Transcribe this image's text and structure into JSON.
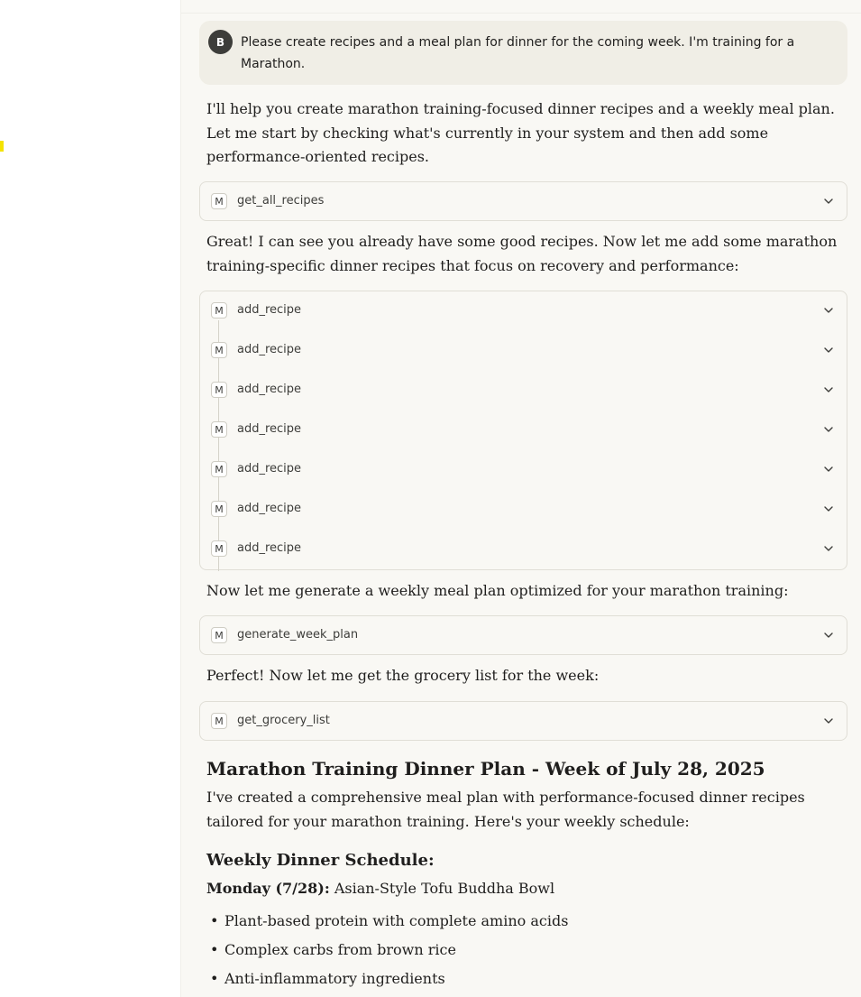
{
  "user_message": {
    "avatar_initial": "B",
    "text": "Please create recipes and a  meal plan for dinner for the coming week. I'm training for a Marathon."
  },
  "assistant": {
    "intro": "I'll help you create marathon training-focused dinner recipes and a weekly meal plan. Let me start by checking what's currently in your system and then add some performance-oriented recipes.",
    "after_get_all": "Great! I can see you already have some good recipes. Now let me add some marathon training-specific dinner recipes that focus on recovery and performance:",
    "before_plan": "Now let me generate a weekly meal plan optimized for your marathon training:",
    "before_grocery": "Perfect! Now let me get the grocery list for the week:",
    "heading": "Marathon Training Dinner Plan - Week of July 28, 2025",
    "summary": "I've created a comprehensive meal plan with performance-focused dinner recipes tailored for your marathon training. Here's your weekly schedule:",
    "schedule_heading": "Weekly Dinner Schedule:",
    "monday_label": "Monday (7/28):",
    "monday_meal": "Asian-Style Tofu Buddha Bowl",
    "monday_points": [
      "Plant-based protein with complete amino acids",
      "Complex carbs from brown rice",
      "Anti-inflammatory ingredients"
    ]
  },
  "tool_badge": "M",
  "tools": {
    "get_all": "get_all_recipes",
    "add_recipe": [
      "add_recipe",
      "add_recipe",
      "add_recipe",
      "add_recipe",
      "add_recipe",
      "add_recipe",
      "add_recipe"
    ],
    "generate_plan": "generate_week_plan",
    "grocery": "get_grocery_list"
  }
}
